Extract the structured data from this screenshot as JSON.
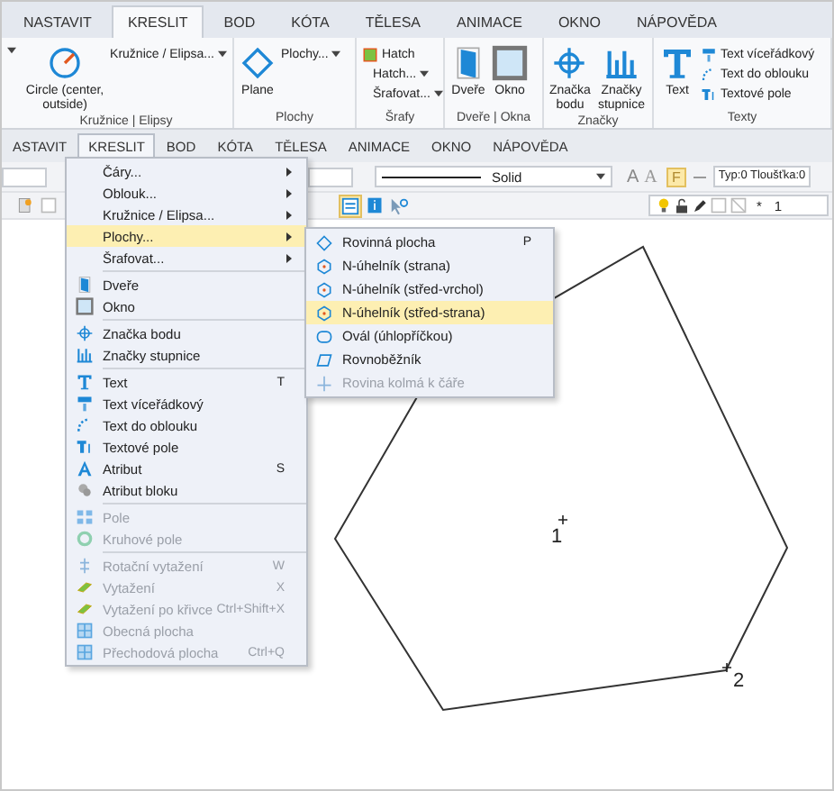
{
  "ribbon": {
    "tabs": [
      {
        "label": "NASTAVIT",
        "selected": false
      },
      {
        "label": "KRESLIT",
        "selected": true
      },
      {
        "label": "BOD",
        "selected": false
      },
      {
        "label": "KÓTA",
        "selected": false
      },
      {
        "label": "TĚLESA",
        "selected": false
      },
      {
        "label": "ANIMACE",
        "selected": false
      },
      {
        "label": "OKNO",
        "selected": false
      },
      {
        "label": "NÁPOVĚDA",
        "selected": false
      }
    ],
    "groups": [
      {
        "label": "Kružnice | Elipsy",
        "items": [
          {
            "kind": "large",
            "label": "Circle (center, outside)"
          },
          {
            "kind": "small",
            "label": "Kružnice / Elipsa...",
            "dropdown": true
          }
        ]
      },
      {
        "label": "Plochy",
        "items": [
          {
            "kind": "large",
            "label": "Plane"
          },
          {
            "kind": "small",
            "label": "Plochy...",
            "dropdown": true
          }
        ]
      },
      {
        "label": "Šrafy",
        "items": [
          {
            "kind": "small",
            "label": "Hatch",
            "dropdown": false
          },
          {
            "kind": "small",
            "label": "Hatch...",
            "dropdown": true
          },
          {
            "kind": "small",
            "label": "Šrafovat...",
            "dropdown": true
          }
        ]
      },
      {
        "label": "Dveře | Okna",
        "items": [
          {
            "kind": "large",
            "label": "Dveře"
          },
          {
            "kind": "large",
            "label": "Okno"
          }
        ]
      },
      {
        "label": "Značky",
        "items": [
          {
            "kind": "large",
            "label": "Značka bodu"
          },
          {
            "kind": "large",
            "label": "Značky stupnice"
          }
        ]
      },
      {
        "label": "Texty",
        "items": [
          {
            "kind": "large",
            "label": "Text"
          },
          {
            "kind": "small",
            "label": "Text víceřádkový",
            "dropdown": false
          },
          {
            "kind": "small",
            "label": "Text do oblouku",
            "dropdown": false
          },
          {
            "kind": "small",
            "label": "Textové pole",
            "dropdown": false
          }
        ]
      }
    ]
  },
  "menu_bar": [
    {
      "label": "ASTAVIT",
      "selected": false
    },
    {
      "label": "KRESLIT",
      "selected": true
    },
    {
      "label": "BOD",
      "selected": false
    },
    {
      "label": "KÓTA",
      "selected": false
    },
    {
      "label": "TĚLESA",
      "selected": false
    },
    {
      "label": "ANIMACE",
      "selected": false
    },
    {
      "label": "OKNO",
      "selected": false
    },
    {
      "label": "NÁPOVĚDA",
      "selected": false
    }
  ],
  "toolbar": {
    "font_buttons": [
      "A",
      "A"
    ],
    "fill_button": "F",
    "line_style": "Solid",
    "line_props": "Typ:0 Tloušťka:0",
    "layer_flag": "*",
    "layer": "1"
  },
  "menu": {
    "sections": [
      {
        "items": [
          {
            "label": "Čáry...",
            "kind": "submenu",
            "selected": false,
            "disabled": false
          },
          {
            "label": "Oblouk...",
            "kind": "submenu",
            "selected": false,
            "disabled": false
          },
          {
            "label": "Kružnice / Elipsa...",
            "kind": "submenu",
            "selected": false,
            "disabled": false
          },
          {
            "label": "Plochy...",
            "kind": "submenu",
            "selected": true,
            "disabled": false
          },
          {
            "label": "Šrafovat...",
            "kind": "submenu",
            "selected": false,
            "disabled": false
          }
        ]
      },
      {
        "items": [
          {
            "label": "Dveře",
            "kind": "command",
            "selected": false,
            "disabled": false
          },
          {
            "label": "Okno",
            "kind": "command",
            "selected": false,
            "disabled": false
          }
        ]
      },
      {
        "items": [
          {
            "label": "Značka bodu",
            "kind": "command",
            "selected": false,
            "disabled": false
          },
          {
            "label": "Značky stupnice",
            "kind": "command",
            "selected": false,
            "disabled": false
          }
        ]
      },
      {
        "items": [
          {
            "label": "Text",
            "kind": "command",
            "shortcut": "T",
            "selected": false,
            "disabled": false
          },
          {
            "label": "Text víceřádkový",
            "kind": "command",
            "selected": false,
            "disabled": false
          },
          {
            "label": "Text do oblouku",
            "kind": "command",
            "selected": false,
            "disabled": false
          },
          {
            "label": "Textové pole",
            "kind": "command",
            "selected": false,
            "disabled": false
          },
          {
            "label": "Atribut",
            "kind": "command",
            "shortcut": "S",
            "selected": false,
            "disabled": false
          },
          {
            "label": "Atribut bloku",
            "kind": "command",
            "selected": false,
            "disabled": false
          }
        ]
      },
      {
        "items": [
          {
            "label": "Pole",
            "kind": "command",
            "selected": false,
            "disabled": true
          },
          {
            "label": "Kruhové pole",
            "kind": "command",
            "selected": false,
            "disabled": true
          }
        ]
      },
      {
        "items": [
          {
            "label": "Rotační vytažení",
            "kind": "command",
            "shortcut": "W",
            "selected": false,
            "disabled": true
          },
          {
            "label": "Vytažení",
            "kind": "command",
            "shortcut": "X",
            "selected": false,
            "disabled": true
          },
          {
            "label": "Vytažení po křivce",
            "kind": "command",
            "shortcut": "Ctrl+Shift+X",
            "selected": false,
            "disabled": true
          },
          {
            "label": "Obecná plocha",
            "kind": "command",
            "selected": false,
            "disabled": true
          },
          {
            "label": "Přechodová plocha",
            "kind": "command",
            "shortcut": "Ctrl+Q",
            "selected": false,
            "disabled": true
          }
        ]
      }
    ]
  },
  "submenu": {
    "items": [
      {
        "label": "Rovinná plocha",
        "shortcut": "P",
        "selected": false,
        "disabled": false
      },
      {
        "label": "N-úhelník (strana)",
        "selected": false,
        "disabled": false
      },
      {
        "label": "N-úhelník (střed-vrchol)",
        "selected": false,
        "disabled": false
      },
      {
        "label": "N-úhelník (střed-strana)",
        "selected": true,
        "disabled": false
      },
      {
        "label": "Ovál (úhlopříčkou)",
        "selected": false,
        "disabled": false
      },
      {
        "label": "Rovnoběžník",
        "selected": false,
        "disabled": false
      },
      {
        "label": "Rovina kolmá k čáře",
        "selected": false,
        "disabled": true
      }
    ]
  },
  "canvas": {
    "points": [
      {
        "label": "1"
      },
      {
        "label": "2"
      }
    ]
  }
}
